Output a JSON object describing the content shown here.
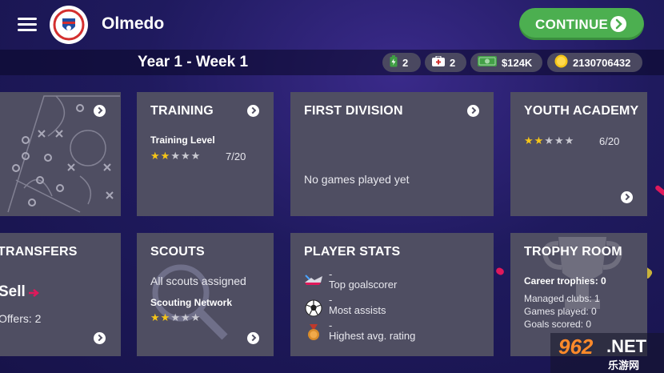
{
  "header": {
    "club_name": "Olmedo",
    "continue_label": "CONTINUE"
  },
  "status": {
    "week": "Year 1 - Week 1",
    "energy": "2",
    "medical": "2",
    "cash": "$124K",
    "coins": "2130706432"
  },
  "cards": {
    "training": {
      "title": "TRAINING",
      "level_label": "Training Level",
      "level_value": "7/20",
      "stars": 1.5
    },
    "first_division": {
      "title": "FIRST DIVISION",
      "message": "No games played yet"
    },
    "youth_academy": {
      "title": "YOUTH ACADEMY",
      "level_value": "6/20",
      "stars": 1.5
    },
    "transfers": {
      "title": "TRANSFERS",
      "sell_label": "Sell",
      "offers": "Offers: 2"
    },
    "scouts": {
      "title": "SCOUTS",
      "status": "All scouts assigned",
      "network_label": "Scouting Network",
      "stars": 1.5
    },
    "player_stats": {
      "title": "PLAYER STATS",
      "rows": [
        {
          "value": "-",
          "label": "Top goalscorer",
          "icon": "boot-icon"
        },
        {
          "value": "-",
          "label": "Most assists",
          "icon": "soccer-ball-icon"
        },
        {
          "value": "-",
          "label": "Highest avg. rating",
          "icon": "medal-icon"
        }
      ]
    },
    "trophy_room": {
      "title": "TROPHY ROOM",
      "career_trophies": "Career trophies: 0",
      "managed_clubs": "Managed clubs: 1",
      "games_played": "Games played: 0",
      "goals_scored": "Goals scored: 0"
    }
  },
  "watermark": {
    "number": "962",
    "suffix": ".NET",
    "sub": "乐游网"
  },
  "colors": {
    "card": "#4f4e62",
    "accent_green": "#4caf50",
    "star": "#f5c518",
    "background": "#1f1a5e"
  }
}
